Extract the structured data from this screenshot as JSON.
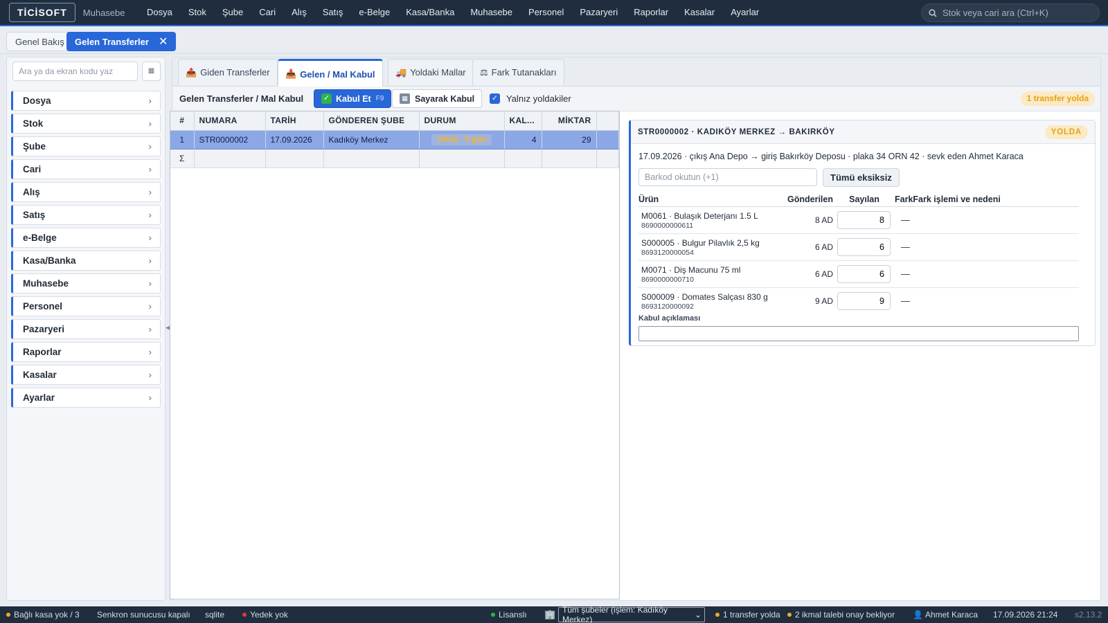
{
  "app": {
    "logo": "TİCİSOFT",
    "subtitle": "Muhasebe",
    "menu": [
      "Dosya",
      "Stok",
      "Şube",
      "Cari",
      "Alış",
      "Satış",
      "e-Belge",
      "Kasa/Banka",
      "Muhasebe",
      "Personel",
      "Pazaryeri",
      "Raporlar",
      "Kasalar",
      "Ayarlar"
    ],
    "search_placeholder": "Stok veya cari ara (Ctrl+K)"
  },
  "doc_tabs": {
    "inactive": "Genel Bakış",
    "active": "Gelen Transferler",
    "close": "✕"
  },
  "sidebar": {
    "search_placeholder": "Ara ya da ekran kodu yaz",
    "items": [
      "Dosya",
      "Stok",
      "Şube",
      "Cari",
      "Alış",
      "Satış",
      "e-Belge",
      "Kasa/Banka",
      "Muhasebe",
      "Personel",
      "Pazaryeri",
      "Raporlar",
      "Kasalar",
      "Ayarlar"
    ]
  },
  "view_tabs": [
    "Giden Transferler",
    "Gelen / Mal Kabul",
    "Yoldaki Mallar",
    "Fark Tutanakları"
  ],
  "toolbar": {
    "title": "Gelen Transferler / Mal Kabul",
    "accept_label": "Kabul Et",
    "accept_key": "F9",
    "count_accept_label": "Sayarak Kabul",
    "only_transit_label": "Yalnız yoldakiler",
    "only_transit_checked": true,
    "transit_badge": "1 transfer yolda"
  },
  "grid": {
    "columns": [
      "#",
      "NUMARA",
      "TARİH",
      "GÖNDEREN ŞUBE",
      "DURUM",
      "KAL...",
      "MİKTAR"
    ],
    "rows": [
      {
        "idx": "1",
        "numara": "STR0000002",
        "tarih": "17.09.2026",
        "gonderen": "Kadıköy Merkez",
        "durum": "Yolda · 0 gün",
        "kalem": "4",
        "miktar": "29"
      }
    ],
    "sum_symbol": "Σ"
  },
  "detail": {
    "header": "STR0000002 · KADIKÖY MERKEZ → BAKIRKÖY",
    "badge": "YOLDA",
    "info": "17.09.2026 · çıkış Ana Depo → giriş Bakırköy Deposu · plaka 34 ORN 42 · sevk eden Ahmet Karaca",
    "barcode_placeholder": "Barkod okutun (+1)",
    "all_complete_label": "Tümü eksiksiz",
    "columns": {
      "product": "Ürün",
      "sent": "Gönderilen",
      "counted": "Sayılan",
      "diff": "Fark",
      "reason": "Fark işlemi ve nedeni"
    },
    "products": [
      {
        "name": "M0061 · Bulaşık Deterjanı 1.5 L",
        "barcode": "8690000000611",
        "sent": "8 AD",
        "counted": "8",
        "diff": "—"
      },
      {
        "name": "S000005 · Bulgur Pilavlık 2,5 kg",
        "barcode": "8693120000054",
        "sent": "6 AD",
        "counted": "6",
        "diff": "—"
      },
      {
        "name": "M0071 · Diş Macunu 75 ml",
        "barcode": "8690000000710",
        "sent": "6 AD",
        "counted": "6",
        "diff": "—"
      },
      {
        "name": "S000009 · Domates Salçası 830 g",
        "barcode": "8693120000092",
        "sent": "9 AD",
        "counted": "9",
        "diff": "—"
      }
    ],
    "note_label": "Kabul açıklaması",
    "note_value": ""
  },
  "statusbar": {
    "kasa": "Bağlı kasa yok / 3",
    "sync": "Senkron sunucusu kapalı",
    "db": "sqlite",
    "backup": "Yedek yok",
    "license": "Lisanslı",
    "branch_select": "Tüm şubeler (işlem: Kadıköy Merkez)",
    "transit": "1 transfer yolda",
    "pending": "2 ikmal talebi onay bekliyor",
    "user": "Ahmet Karaca",
    "datetime": "17.09.2026 21:24",
    "version": "s2.13.2"
  },
  "colors": {
    "accent": "#2867d8",
    "topbar": "#1f2d3e",
    "transit_badge_text": "#e3a21a",
    "ok_green": "#2fb34a"
  }
}
